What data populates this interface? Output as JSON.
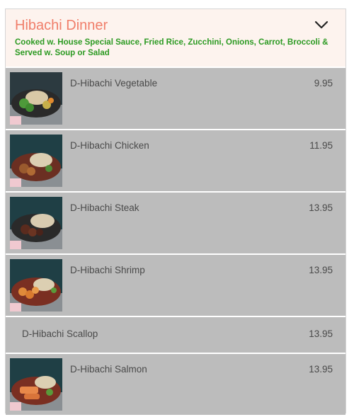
{
  "section": {
    "title": "Hibachi Dinner",
    "description": "Cooked w. House Special Sauce, Fried Rice, Zucchini, Onions, Carrot, Broccoli & Served w. Soup or Salad",
    "toggle_icon": "chevron-down-icon"
  },
  "items": [
    {
      "name": "D-Hibachi Vegetable",
      "price": "9.95",
      "has_image": true,
      "image": "vegetable-dish-photo"
    },
    {
      "name": "D-Hibachi Chicken",
      "price": "11.95",
      "has_image": true,
      "image": "chicken-dish-photo"
    },
    {
      "name": "D-Hibachi Steak",
      "price": "13.95",
      "has_image": true,
      "image": "steak-dish-photo"
    },
    {
      "name": "D-Hibachi Shrimp",
      "price": "13.95",
      "has_image": true,
      "image": "shrimp-dish-photo"
    },
    {
      "name": "D-Hibachi Scallop",
      "price": "13.95",
      "has_image": false
    },
    {
      "name": "D-Hibachi Salmon",
      "price": "13.95",
      "has_image": true,
      "image": "salmon-dish-photo"
    }
  ],
  "colors": {
    "title": "#f07e6a",
    "description": "#2c9a22",
    "header_bg": "#fdf3ee",
    "row_bg": "#bcbcbc"
  }
}
